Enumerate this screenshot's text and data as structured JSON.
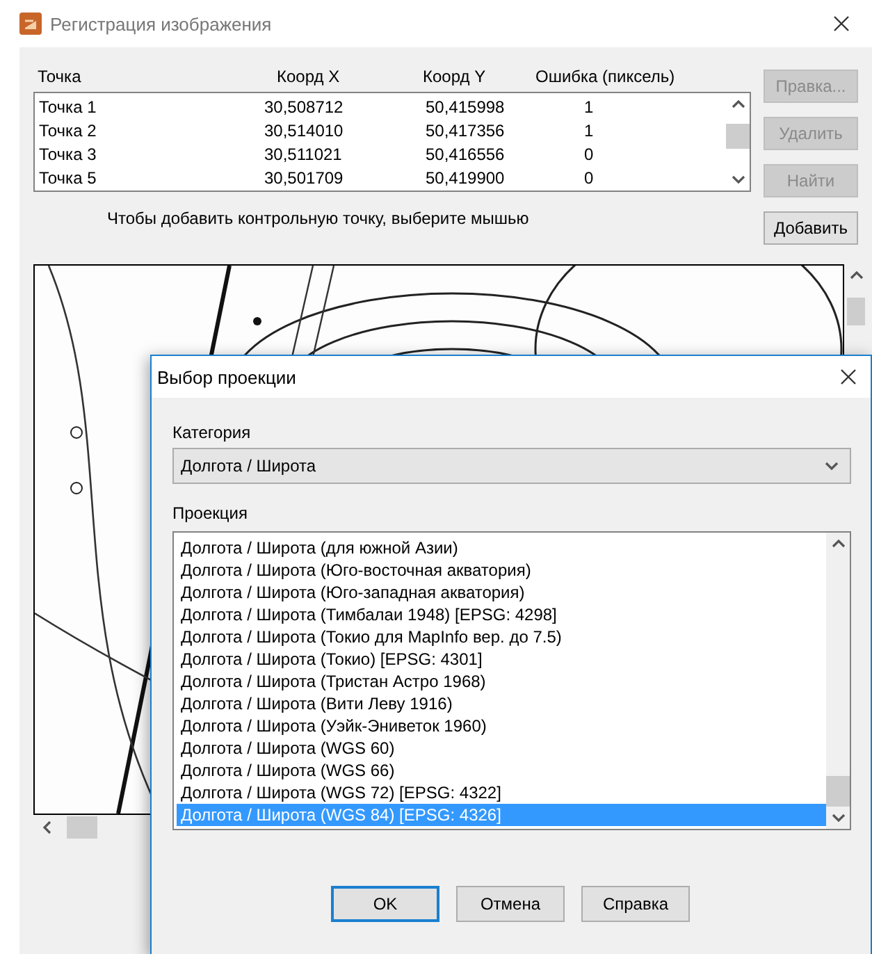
{
  "window": {
    "title": "Регистрация изображения"
  },
  "points_table": {
    "columns": [
      "Точка",
      "Коорд X",
      "Коорд Y",
      "Ошибка (пиксель)"
    ],
    "rows": [
      [
        "Точка 1",
        "30,508712",
        "50,415998",
        "1"
      ],
      [
        "Точка 2",
        "30,514010",
        "50,417356",
        "1"
      ],
      [
        "Точка 3",
        "30,511021",
        "50,416556",
        "0"
      ],
      [
        "Точка 5",
        "30,501709",
        "50,419900",
        "0"
      ]
    ]
  },
  "side_buttons": [
    {
      "label": "Правка...",
      "disabled": true
    },
    {
      "label": "Удалить",
      "disabled": true
    },
    {
      "label": "Найти",
      "disabled": true
    },
    {
      "label": "Добавить",
      "disabled": false
    }
  ],
  "hint": "Чтобы добавить контрольную точку, выберите мышью",
  "dialog": {
    "title": "Выбор проекции",
    "category_label": "Категория",
    "category_value": "Долгота / Широта",
    "projection_label": "Проекция",
    "projections": [
      {
        "label": "Долгота / Широта (для южной Азии)",
        "selected": false
      },
      {
        "label": "Долгота / Широта (Юго-восточная акватория)",
        "selected": false
      },
      {
        "label": "Долгота / Широта (Юго-западная акватория)",
        "selected": false
      },
      {
        "label": "Долгота / Широта (Тимбалаи 1948) [EPSG: 4298]",
        "selected": false
      },
      {
        "label": "Долгота / Широта (Токио для MapInfo вер. до 7.5)",
        "selected": false
      },
      {
        "label": "Долгота / Широта (Токио) [EPSG: 4301]",
        "selected": false
      },
      {
        "label": "Долгота / Широта (Тристан Астро 1968)",
        "selected": false
      },
      {
        "label": "Долгота / Широта (Вити Леву 1916)",
        "selected": false
      },
      {
        "label": "Долгота / Широта (Уэйк-Эниветок 1960)",
        "selected": false
      },
      {
        "label": "Долгота / Широта (WGS 60)",
        "selected": false
      },
      {
        "label": "Долгота / Широта (WGS 66)",
        "selected": false
      },
      {
        "label": "Долгота / Широта (WGS 72) [EPSG: 4322]",
        "selected": false
      },
      {
        "label": "Долгота / Широта (WGS 84) [EPSG: 4326]",
        "selected": true
      }
    ],
    "buttons": [
      {
        "label": "OK",
        "default": true
      },
      {
        "label": "Отмена",
        "default": false
      },
      {
        "label": "Справка",
        "default": false
      }
    ]
  }
}
